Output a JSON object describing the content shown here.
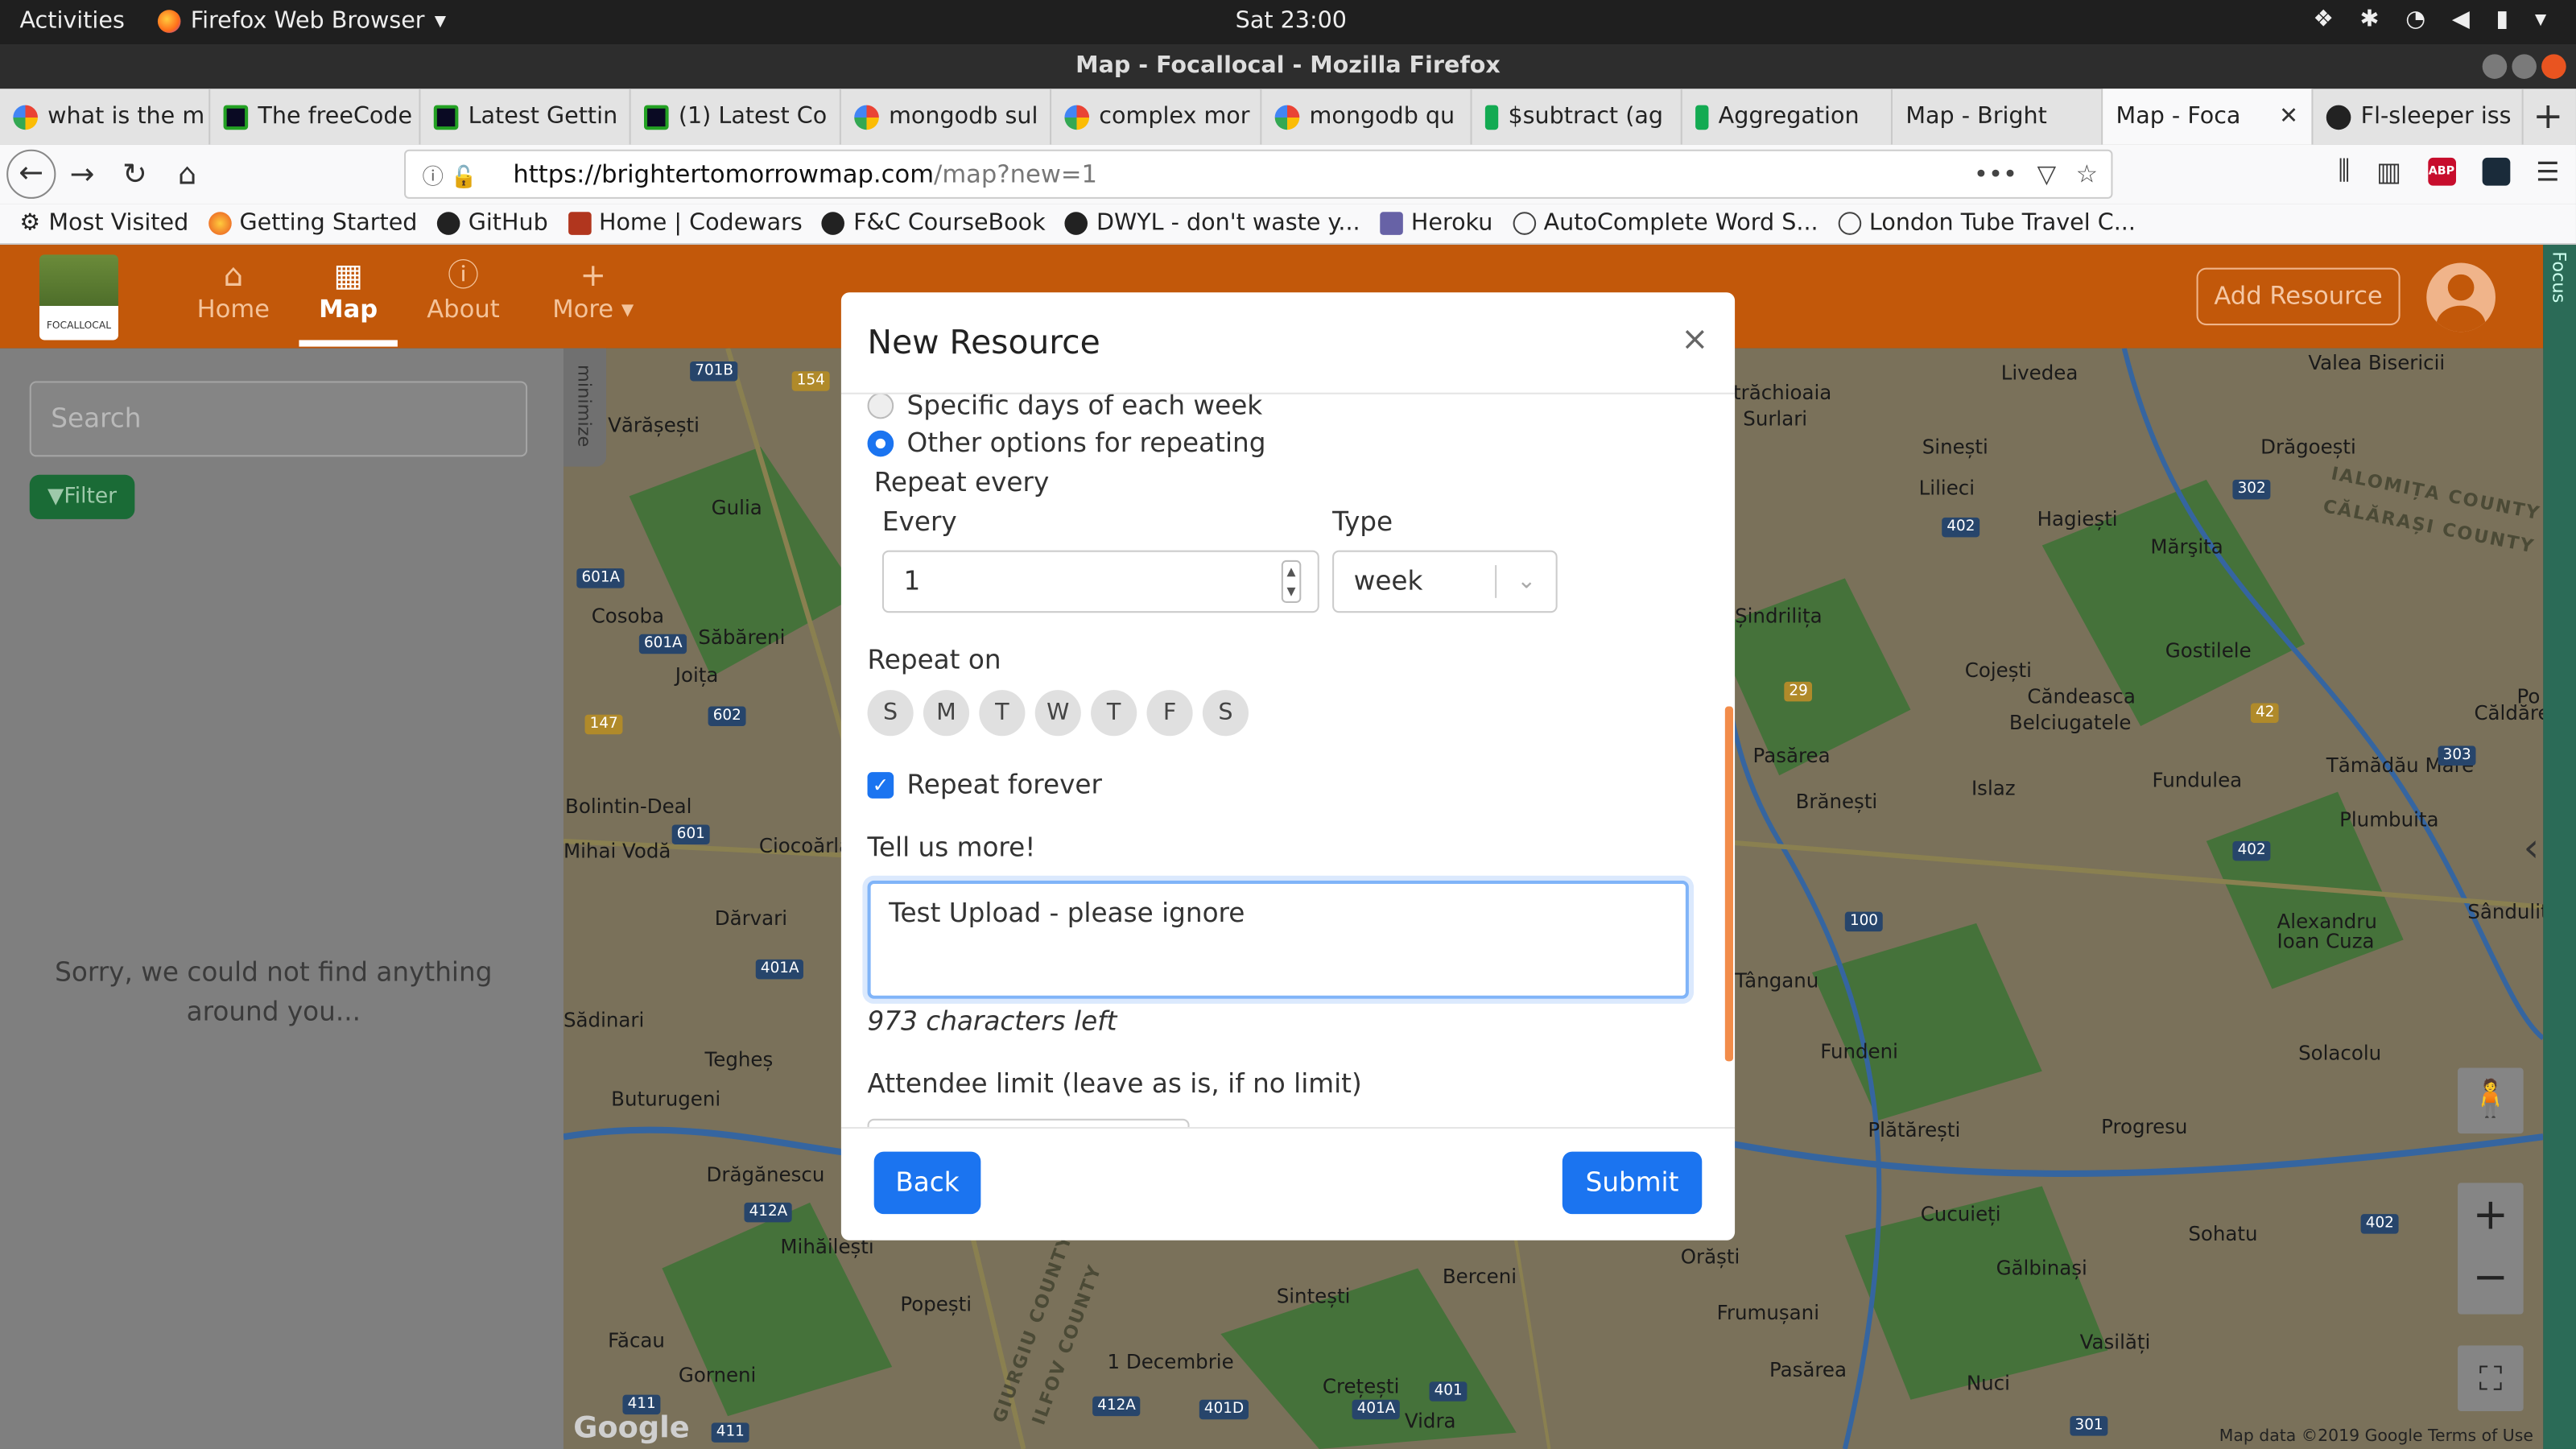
{
  "os": {
    "activities": "Activities",
    "app_name": "Firefox Web Browser",
    "clock": "Sat 23:00"
  },
  "window": {
    "title": "Map - Focallocal - Mozilla Firefox"
  },
  "tabs": [
    {
      "label": "what is the m",
      "icon": "google"
    },
    {
      "label": "The freeCode",
      "icon": "freecodecamp"
    },
    {
      "label": "Latest Gettin",
      "icon": "freecodecamp"
    },
    {
      "label": "(1) Latest Co",
      "icon": "freecodecamp"
    },
    {
      "label": "mongodb sul",
      "icon": "google"
    },
    {
      "label": "complex mor",
      "icon": "google"
    },
    {
      "label": "mongodb qu",
      "icon": "google"
    },
    {
      "label": "$subtract (ag",
      "icon": "mongodb"
    },
    {
      "label": "Aggregation",
      "icon": "mongodb"
    },
    {
      "label": "Map - Bright",
      "icon": "map"
    },
    {
      "label": "Map - Foca",
      "icon": "map",
      "active": true
    },
    {
      "label": "Fl-sleeper iss",
      "icon": "github"
    }
  ],
  "url": {
    "host": "https://brightertomorrowmap.com",
    "path": "/map?new=1"
  },
  "bookmarks": [
    "Most Visited",
    "Getting Started",
    "GitHub",
    "Home | Codewars",
    "F&C CourseBook",
    "DWYL - don't waste y...",
    "Heroku",
    "AutoComplete Word S...",
    "London Tube Travel C..."
  ],
  "app": {
    "nav": [
      {
        "label": "Home",
        "icon": "home-icon"
      },
      {
        "label": "Map",
        "icon": "map-icon",
        "active": true
      },
      {
        "label": "About",
        "icon": "info-icon"
      },
      {
        "label": "More ▾",
        "icon": "plus-icon"
      }
    ],
    "add_resource": "Add Resource",
    "focus_label": "Focus",
    "logo_text": "FOCALLOCAL",
    "search_placeholder": "Search",
    "filter_label": "Filter",
    "no_results": "Sorry, we could not find anything around you...",
    "minimize_label": "minimize"
  },
  "map": {
    "towns": [
      "Livedea",
      "Valea Bisericii",
      "trăchioaia",
      "Surlari",
      "Sinești",
      "Drăgoești",
      "Lilieci",
      "Hagiești",
      "Mărşita",
      "Vărășești",
      "Gulia",
      "Cosoba",
      "Săbăreni",
      "Joița",
      "Șindrilița",
      "Cojești",
      "Gostilele",
      "Căndeasca",
      "Belciugatele",
      "Pasărea",
      "Brănești",
      "Islaz",
      "Fundulea",
      "Tămădău Mare",
      "Plumbuita",
      "Bolintin-Deal",
      "Mihai Vodă",
      "Ciocoărla",
      "Dărvari",
      "Alexandru Ioan Cuza",
      "Sădinari",
      "Tegheș",
      "Tânganu",
      "Fundeni",
      "Solacolu",
      "Buturugeni",
      "Drăgănescu",
      "Plătărești",
      "Progresu",
      "Mihăilești",
      "Cucuieți",
      "Sohatu",
      "Gălbinași",
      "Orăști",
      "Berceni",
      "Popești",
      "Sintești",
      "Frumușani",
      "Făcau",
      "Gorneni",
      "Vasilăți",
      "1 Decembrie",
      "Crețești",
      "Vidra",
      "Pasărea",
      "Nuci",
      "Sândulițe",
      "Căldăreți",
      "Po"
    ],
    "counties": [
      "IALOMIȚA COUNTY",
      "CĂLĂRAȘI COUNTY",
      "GIURGIU COUNTY",
      "ILFOV COUNTY"
    ],
    "roads": [
      "701B",
      "154",
      "601A",
      "601A",
      "147",
      "602",
      "601",
      "401A",
      "412A",
      "411",
      "411",
      "412A",
      "401D",
      "401A",
      "401",
      "402",
      "302",
      "42",
      "29",
      "303",
      "100",
      "402",
      "402",
      "301"
    ],
    "attribution": "Map data ©2019 Google   Terms of Use",
    "google_label": "Google"
  },
  "modal": {
    "title": "New Resource",
    "close": "×",
    "option_specific": "Specific days of each week",
    "option_other": "Other options for repeating",
    "repeat_every": "Repeat every",
    "every_label": "Every",
    "every_value": "1",
    "type_label": "Type",
    "type_value": "week",
    "repeat_on": "Repeat on",
    "days": [
      "S",
      "M",
      "T",
      "W",
      "T",
      "F",
      "S"
    ],
    "repeat_forever": "Repeat forever",
    "tell_more": "Tell us more!",
    "description": "Test Upload - please ignore",
    "chars_left": "973 characters left",
    "attendee_label": "Attendee limit (leave as is, if no limit)",
    "back": "Back",
    "submit": "Submit"
  }
}
